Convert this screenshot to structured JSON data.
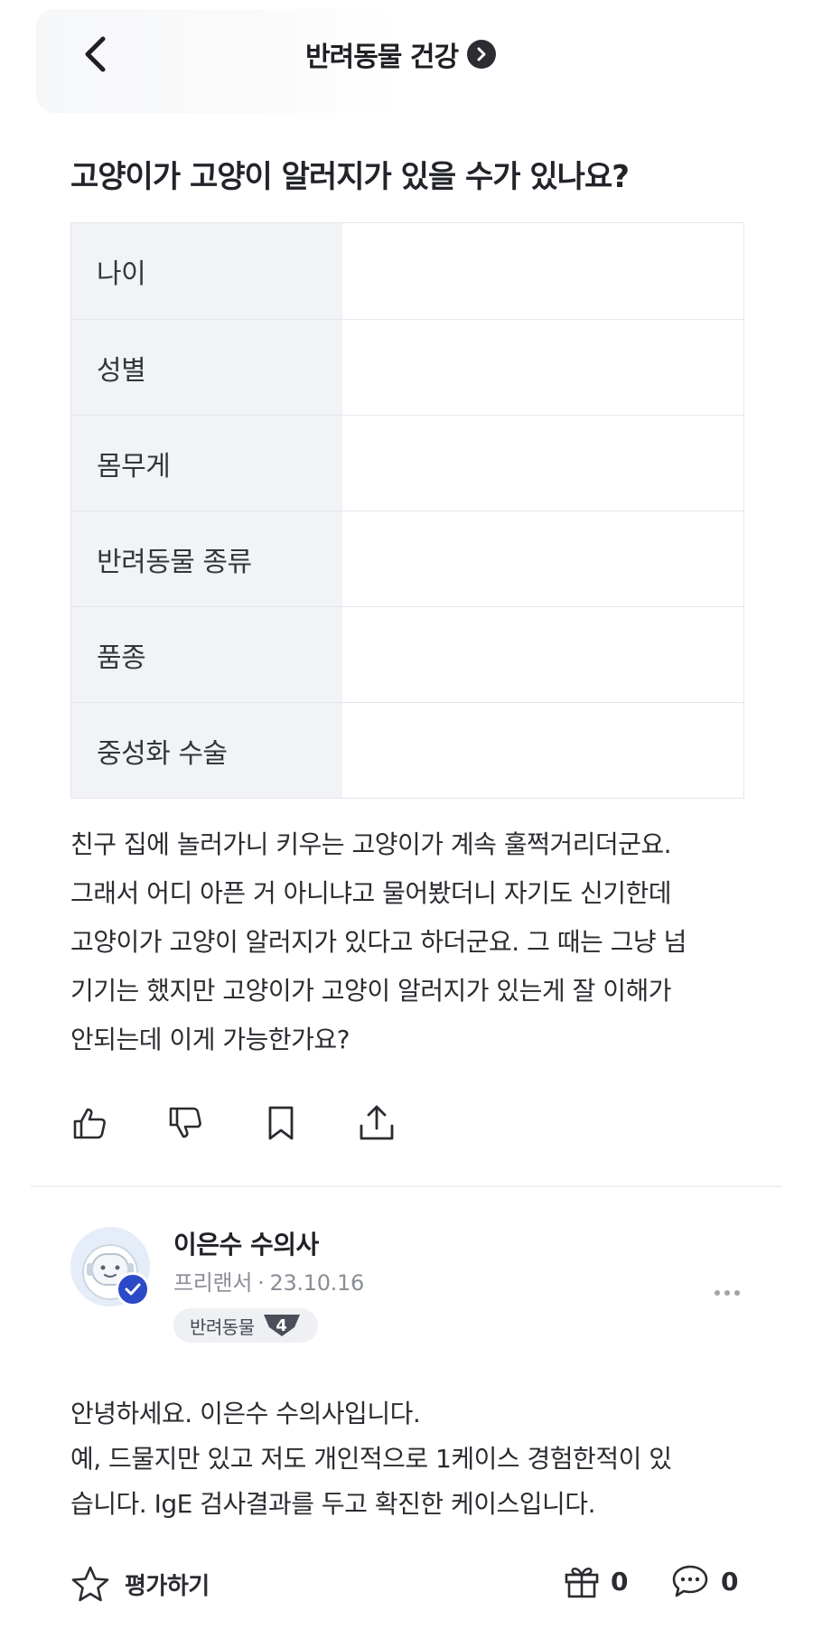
{
  "header": {
    "title": "반려동물 건강"
  },
  "question": {
    "title": "고양이가 고양이 알러지가 있을 수가 있나요?"
  },
  "info_table": {
    "rows": [
      {
        "label": "나이",
        "value": ""
      },
      {
        "label": "성별",
        "value": ""
      },
      {
        "label": "몸무게",
        "value": ""
      },
      {
        "label": "반려동물 종류",
        "value": ""
      },
      {
        "label": "품종",
        "value": ""
      },
      {
        "label": "중성화 수술",
        "value": ""
      }
    ]
  },
  "body": {
    "lines": [
      "친구 집에 놀러가니 키우는 고양이가 계속 훌쩍거리더군요.",
      "그래서 어디 아픈 거 아니냐고 물어봤더니 자기도 신기한데",
      "고양이가 고양이 알러지가 있다고 하더군요. 그 때는 그냥 넘",
      "기기는 했지만 고양이가 고양이 알러지가 있는게 잘 이해가",
      "안되는데 이게 가능한가요?"
    ]
  },
  "actions": {
    "icons": [
      "thumbs-up-icon",
      "thumbs-down-icon",
      "bookmark-icon",
      "share-icon"
    ]
  },
  "answer": {
    "author_name": "이은수 수의사",
    "author_role": "프리랜서",
    "date": "23.10.16",
    "badge_label": "반려동물",
    "badge_level": "4",
    "lines": [
      "안녕하세요. 이은수 수의사입니다.",
      "예, 드물지만 있고 저도 개인적으로 1케이스 경험한적이 있",
      "습니다. IgE 검사결과를 두고 확진한 케이스입니다."
    ]
  },
  "footer": {
    "rate_label": "평가하기",
    "gift_count": "0",
    "comment_count": "0"
  },
  "colors": {
    "accent_blue": "#2c49c7",
    "table_label_bg": "#f1f3f6",
    "text_dark": "#22242a"
  }
}
